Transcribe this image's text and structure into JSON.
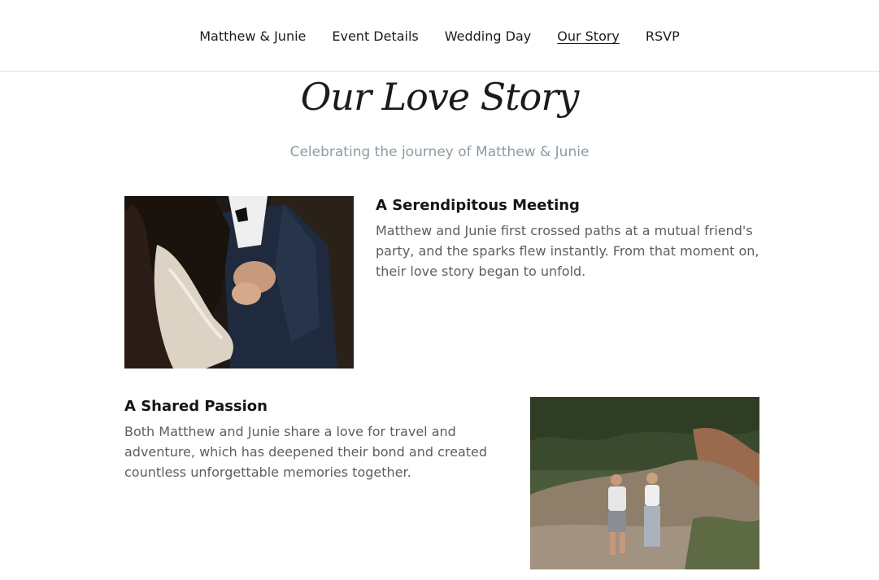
{
  "nav": {
    "items": [
      {
        "label": "Matthew & Junie"
      },
      {
        "label": "Event Details"
      },
      {
        "label": "Wedding Day"
      },
      {
        "label": "Our Story"
      },
      {
        "label": "RSVP"
      }
    ],
    "active": "Our Story"
  },
  "header": {
    "title": "Our Love Story",
    "subtitle": "Celebrating the journey of Matthew & Junie"
  },
  "stories": [
    {
      "heading": "A Serendipitous Meeting",
      "body": "Matthew and Junie first crossed paths at a mutual friend's party, and the sparks flew instantly. From that moment on, their love story began to unfold.",
      "photo": "couple-dancing-photo"
    },
    {
      "heading": "A Shared Passion",
      "body": "Both Matthew and Junie share a love for travel and adventure, which has deepened their bond and created countless unforgettable memories together.",
      "photo": "couple-hiking-photo"
    }
  ],
  "colors": {
    "subtitle": "#8d9ba3",
    "body_text": "#5a5f64",
    "divider": "#e3e3e3"
  }
}
